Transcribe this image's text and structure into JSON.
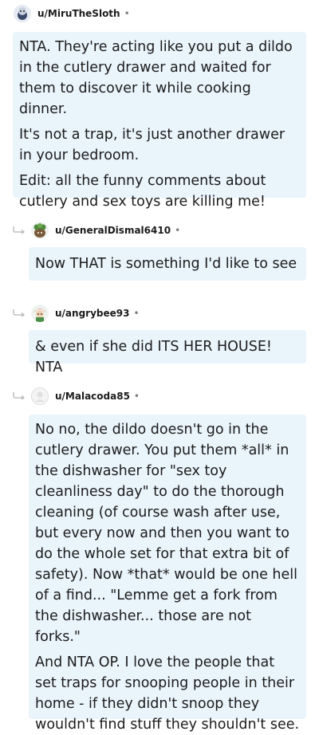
{
  "comments": [
    {
      "username": "u/MiruTheSloth",
      "separator": "•",
      "avatar_icon": "sloth-avatar-icon",
      "paragraphs": [
        "NTA. They're acting like you put a dildo in the cutlery drawer and waited for them to discover it while cooking dinner.",
        "It's not a trap, it's just another drawer in your bedroom.",
        "Edit: all the funny comments about cutlery and sex toys are killing me!"
      ]
    },
    {
      "username": "u/GeneralDismal6410",
      "separator": "•",
      "avatar_icon": "plant-avatar-icon",
      "paragraphs": [
        "Now THAT is something I'd like to see"
      ]
    },
    {
      "username": "u/angrybee93",
      "separator": "•",
      "avatar_icon": "red-hair-avatar-icon",
      "paragraphs": [
        "& even if she did ITS HER HOUSE! NTA"
      ]
    },
    {
      "username": "u/Malacoda85",
      "separator": "•",
      "avatar_icon": "default-avatar-icon",
      "paragraphs": [
        "No no, the dildo doesn't go in the cutlery drawer. You put them *all* in the dishwasher for \"sex toy cleanliness day\" to do the thorough cleaning (of course wash after use, but every now and then you want to do the whole set for that extra bit of safety). Now *that* would be one hell of a find... \"Lemme get a fork from the dishwasher... those are not forks.\"",
        "And NTA OP. I love the people that set traps for snooping people in their home - if they didn't snoop they wouldn't find stuff they shouldn't see."
      ]
    }
  ],
  "colors": {
    "bubble_bg": "#eaf4fb",
    "text": "#1c1c1c",
    "meta": "#7c7c7c"
  }
}
